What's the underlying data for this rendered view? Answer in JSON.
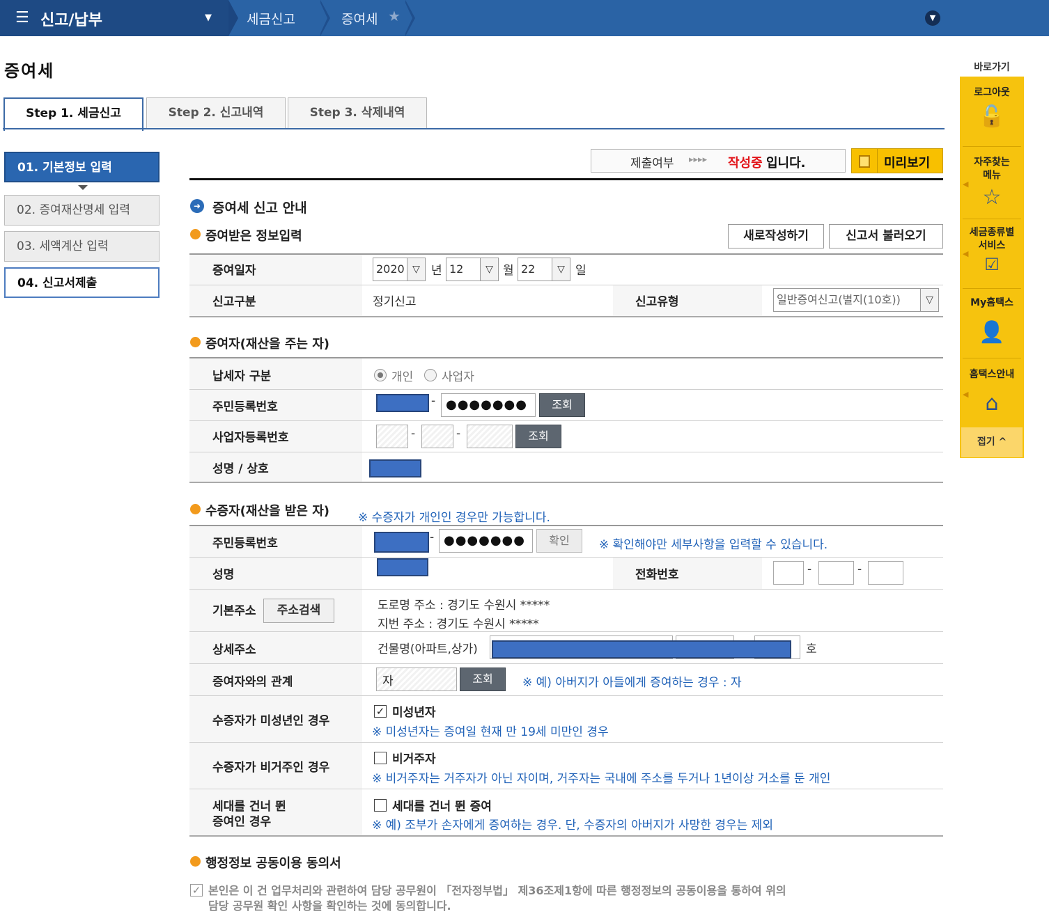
{
  "topbar": {
    "menu_icon": "hamburger-icon",
    "menu_title": "신고/납부",
    "breadcrumb_1": "세금신고",
    "breadcrumb_2": "증여세",
    "star_icon": "star-icon",
    "expand_icon": "chevron-down-icon"
  },
  "page_title": "증여세",
  "tabs": [
    {
      "label": "Step 1. 세금신고"
    },
    {
      "label": "Step 2. 신고내역"
    },
    {
      "label": "Step 3. 삭제내역"
    }
  ],
  "steps": [
    {
      "label": "01. 기본정보 입력"
    },
    {
      "label": "02. 증여재산명세 입력"
    },
    {
      "label": "03. 세액계산 입력"
    },
    {
      "label": "04. 신고서제출"
    }
  ],
  "status": {
    "submit_label": "제출여부",
    "arrows": "▸▸▸▸",
    "state_highlight": "작성중",
    "state_rest": "입니다.",
    "preview_button": "미리보기"
  },
  "guide_title": "증여세 신고 안내",
  "gift_info": {
    "title": "증여받은 정보입력",
    "new_button": "새로작성하기",
    "load_button": "신고서 불러오기",
    "date_label": "증여일자",
    "year": "2020",
    "year_unit": "년",
    "month": "12",
    "month_unit": "월",
    "day": "22",
    "day_unit": "일",
    "report_kind_label": "신고구분",
    "report_kind_value": "정기신고",
    "report_type_label": "신고유형",
    "report_type_value": "일반증여신고(별지(10호))"
  },
  "donor": {
    "title": "증여자(재산을 주는 자)",
    "taxpayer_type_label": "납세자 구분",
    "option_individual": "개인",
    "option_business": "사업자",
    "rrn_label": "주민등록번호",
    "rrn_back": "●●●●●●●",
    "lookup_button": "조회",
    "brn_label": "사업자등록번호",
    "brn_lookup_button": "조회",
    "name_label": "성명 / 상호"
  },
  "donee": {
    "title": "수증자(재산을 받은 자)",
    "title_note": "※ 수증자가 개인인 경우만 가능합니다.",
    "rrn_label": "주민등록번호",
    "rrn_back": "●●●●●●●",
    "confirm_button": "확인",
    "confirm_note": "※ 확인해야만 세부사항을 입력할 수 있습니다.",
    "name_label": "성명",
    "phone_label": "전화번호",
    "address_label": "기본주소",
    "address_search_button": "주소검색",
    "road_address": "도로명 주소 :   경기도 수원시 *****",
    "lot_address": "지번 주소 :   경기도 수원시 *****",
    "detail_address_label": "상세주소",
    "building_label": "건물명(아파트,상가)",
    "ho_unit": "호",
    "relation_label": "증여자와의 관계",
    "relation_value": "자",
    "relation_lookup_button": "조회",
    "relation_note": "※ 예) 아버지가 아들에게 증여하는 경우 : 자",
    "minor_label": "수증자가 미성년인 경우",
    "minor_check": "미성년자",
    "minor_checked": true,
    "minor_note": "※ 미성년자는 증여일 현재 만 19세 미만인 경우",
    "nonres_label": "수증자가 비거주인 경우",
    "nonres_check": "비거주자",
    "nonres_note": "※ 비거주자는 거주자가 아닌 자이며, 거주자는 국내에 주소를 두거나 1년이상 거소를 둔 개인",
    "skip_label_1": "세대를 건너 뛴",
    "skip_label_2": "증여인 경우",
    "skip_check": "세대를 건너 뛴 증여",
    "skip_note": "※ 예) 조부가 손자에게 증여하는 경우. 단, 수증자의 아버지가 사망한 경우는 제외"
  },
  "consent": {
    "title": "행정정보 공동이용 동의서",
    "text_1": "본인은 이 건 업무처리와 관련하여 담당 공무원이 「전자정부법」 제36조제1항에 따른 행정정보의 공동이용을 통하여 위의",
    "text_2": "담당 공무원 확인 사항을 확인하는 것에 동의합니다."
  },
  "quick": {
    "title": "바로가기",
    "items": [
      {
        "label_1": "로그아웃",
        "label_2": "",
        "icon": "unlock-icon"
      },
      {
        "label_1": "자주찾는",
        "label_2": "메뉴",
        "icon": "star-icon"
      },
      {
        "label_1": "세금종류별",
        "label_2": "서비스",
        "icon": "check-icon"
      },
      {
        "label_1": "My홈택스",
        "label_2": "",
        "icon": "user-icon"
      },
      {
        "label_1": "홈택스안내",
        "label_2": "",
        "icon": "house-icon"
      }
    ],
    "fold": "접기 ^"
  }
}
